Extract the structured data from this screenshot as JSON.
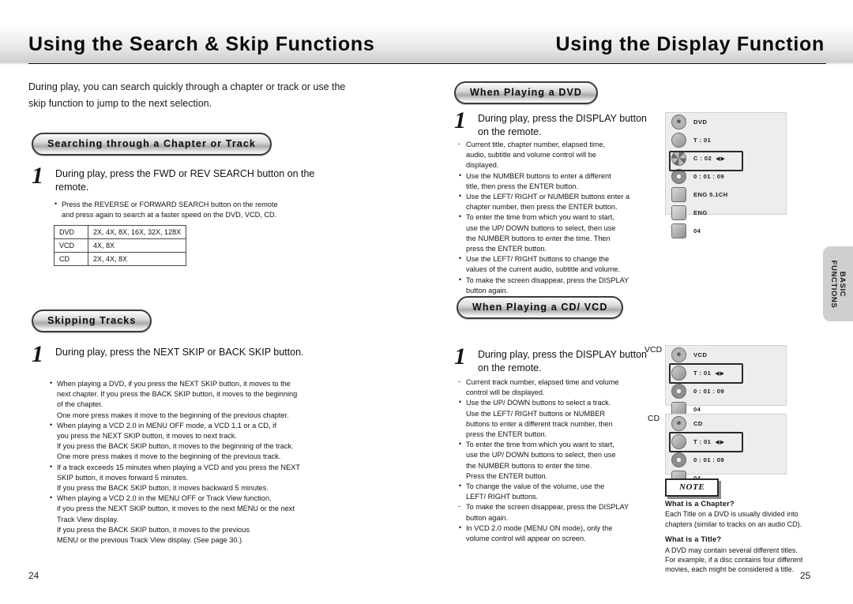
{
  "left_page": {
    "title": "Using the Search & Skip Functions",
    "intro": "During play, you can search quickly through a chapter or track or use the skip function to jump to the next selection.",
    "section1": {
      "heading": "Searching through a Chapter or Track",
      "step_number": "1",
      "step_text": "During play, press the FWD or REV SEARCH button on the remote.",
      "bullets": [
        "Press the REVERSE or FORWARD SEARCH button on the remote",
        "and press again to search at a faster speed on the DVD, VCD, CD."
      ],
      "table": {
        "rows": [
          {
            "label": "DVD",
            "value": "2X, 4X, 8X, 16X, 32X, 128X"
          },
          {
            "label": "VCD",
            "value": "4X, 8X"
          },
          {
            "label": "CD",
            "value": "2X, 4X, 8X"
          }
        ]
      }
    },
    "section2": {
      "heading": "Skipping Tracks",
      "step_number": "1",
      "step_text": "During play, press the NEXT SKIP or BACK SKIP button.",
      "bullets": [
        {
          "bullet": "•",
          "lines": [
            "When playing a DVD, if you press the NEXT SKIP button, it moves to the",
            "next chapter. If you press the BACK SKIP button, it moves to the beginning",
            "of the chapter.",
            "One more press makes it move to the beginning of the previous chapter."
          ]
        },
        {
          "bullet": "•",
          "lines": [
            "When playing a VCD 2.0 in MENU OFF mode, a VCD 1.1 or a CD, if",
            "you press the NEXT SKIP button, it moves to next track.",
            "If you press the BACK SKIP button, it moves to the beginning of the track.",
            "One more press makes it move to the beginning of the previous track."
          ]
        },
        {
          "bullet": "•",
          "lines": [
            "If a track exceeds 15 minutes when playing a VCD and you press the NEXT",
            "SKIP button, it moves forward 5 minutes.",
            "If you press the BACK SKIP button, it moves backward 5 minutes."
          ]
        },
        {
          "bullet": "•",
          "lines": [
            "When playing a VCD 2.0 in the MENU OFF or Track View function,",
            "if you press the NEXT SKIP button, it moves to the next MENU or the next",
            "Track View display.",
            "If you press the BACK SKIP button, it moves to the previous",
            "MENU or the previous Track View display. (See page 30.)"
          ]
        }
      ]
    },
    "page_number": "24"
  },
  "right_page": {
    "title": "Using the Display Function",
    "section1": {
      "heading": "When Playing a DVD",
      "step_number": "1",
      "step_text": "During play, press the DISPLAY button on the remote.",
      "bullets": [
        {
          "bullet": "-",
          "lines": [
            "Current title, chapter number, elapsed time,",
            "audio, subtitle and volume control will be",
            "displayed."
          ]
        },
        {
          "bullet": "•",
          "lines": [
            "Use the NUMBER buttons to enter a different",
            "title, then press the ENTER button."
          ]
        },
        {
          "bullet": "•",
          "lines": [
            "Use the LEFT/ RIGHT or NUMBER buttons enter a",
            "chapter number, then press the ENTER button."
          ]
        },
        {
          "bullet": "•",
          "lines": [
            "To enter the time from which you want to start,",
            "use the UP/ DOWN buttons to select, then use",
            "the NUMBER buttons to enter the time. Then",
            "press the ENTER button."
          ]
        },
        {
          "bullet": "•",
          "lines": [
            "Use the LEFT/ RIGHT buttons to change the",
            "values of the current audio, subtitle and volume."
          ]
        },
        {
          "bullet": "•",
          "lines": [
            "To make the screen disappear, press the DISPLAY",
            "button again."
          ]
        }
      ],
      "osd": {
        "rows": [
          {
            "icon": "disc-icon",
            "label": "DVD",
            "arrows": "",
            "highlight": false
          },
          {
            "icon": "title-icon",
            "label": "T : 01",
            "arrows": "",
            "highlight": false
          },
          {
            "icon": "chapter-icon",
            "label": "C : 02",
            "arrows": "◀▶",
            "highlight": true
          },
          {
            "icon": "clock-icon",
            "label": "0 : 01 : 09",
            "arrows": "",
            "highlight": false
          },
          {
            "icon": "audio-icon",
            "label": "ENG 5.1CH",
            "arrows": "",
            "highlight": false
          },
          {
            "icon": "subtitle-icon",
            "label": "ENG",
            "arrows": "",
            "highlight": false
          },
          {
            "icon": "volume-icon",
            "label": "04",
            "arrows": "",
            "highlight": false
          }
        ]
      }
    },
    "section2": {
      "heading": "When Playing a CD/ VCD",
      "step_number": "1",
      "step_text": "During play, press the DISPLAY button on the remote.",
      "bullets": [
        {
          "bullet": "-",
          "lines": [
            "Current track number, elapsed time and volume",
            "control will be displayed."
          ]
        },
        {
          "bullet": "•",
          "lines": [
            "Use the UP/ DOWN buttons to select a track.",
            "Use the LEFT/ RIGHT buttons or NUMBER",
            "buttons to enter a different track number, then",
            "press the ENTER button."
          ]
        },
        {
          "bullet": "•",
          "lines": [
            "To enter the time from which you want to start,",
            "use the UP/ DOWN buttons to select, then use",
            "the NUMBER buttons to enter the time.",
            "Press the ENTER button."
          ]
        },
        {
          "bullet": "•",
          "lines": [
            "To change the value of the volume, use the",
            "LEFT/ RIGHT buttons."
          ]
        },
        {
          "bullet": "-",
          "lines": [
            "To make the screen disappear, press the DISPLAY",
            "button again."
          ]
        },
        {
          "bullet": "•",
          "lines": [
            "In VCD 2.0 mode (MENU ON mode), only the",
            "volume control will appear on screen."
          ]
        }
      ],
      "osd_vcd": {
        "tag": "VCD",
        "rows": [
          {
            "icon": "disc-icon",
            "label": "VCD",
            "arrows": "",
            "highlight": false
          },
          {
            "icon": "track-icon",
            "label": "T : 01",
            "arrows": "◀▶",
            "highlight": true
          },
          {
            "icon": "clock-icon",
            "label": "0 : 01 : 09",
            "arrows": "",
            "highlight": false
          },
          {
            "icon": "volume-icon",
            "label": "04",
            "arrows": "",
            "highlight": false
          }
        ]
      },
      "osd_cd": {
        "tag": "CD",
        "rows": [
          {
            "icon": "disc-icon",
            "label": "CD",
            "arrows": "",
            "highlight": false
          },
          {
            "icon": "track-icon",
            "label": "T : 01",
            "arrows": "◀▶",
            "highlight": true
          },
          {
            "icon": "clock-icon",
            "label": "0 : 01 : 09",
            "arrows": "",
            "highlight": false
          },
          {
            "icon": "volume-icon",
            "label": "04",
            "arrows": "",
            "highlight": false
          }
        ]
      }
    },
    "note": {
      "label": "NOTE",
      "items": [
        {
          "heading": "What is a Chapter?",
          "body": "Each Title on a DVD is usually divided into chapters (similar to tracks on an audio CD)."
        },
        {
          "heading": "What is a Title?",
          "body": "A DVD may contain several different titles. For example, if a disc contains four different movies, each might be considered a title."
        }
      ]
    },
    "side_tab": "BASIC\nFUNCTIONS",
    "page_number": "25"
  }
}
